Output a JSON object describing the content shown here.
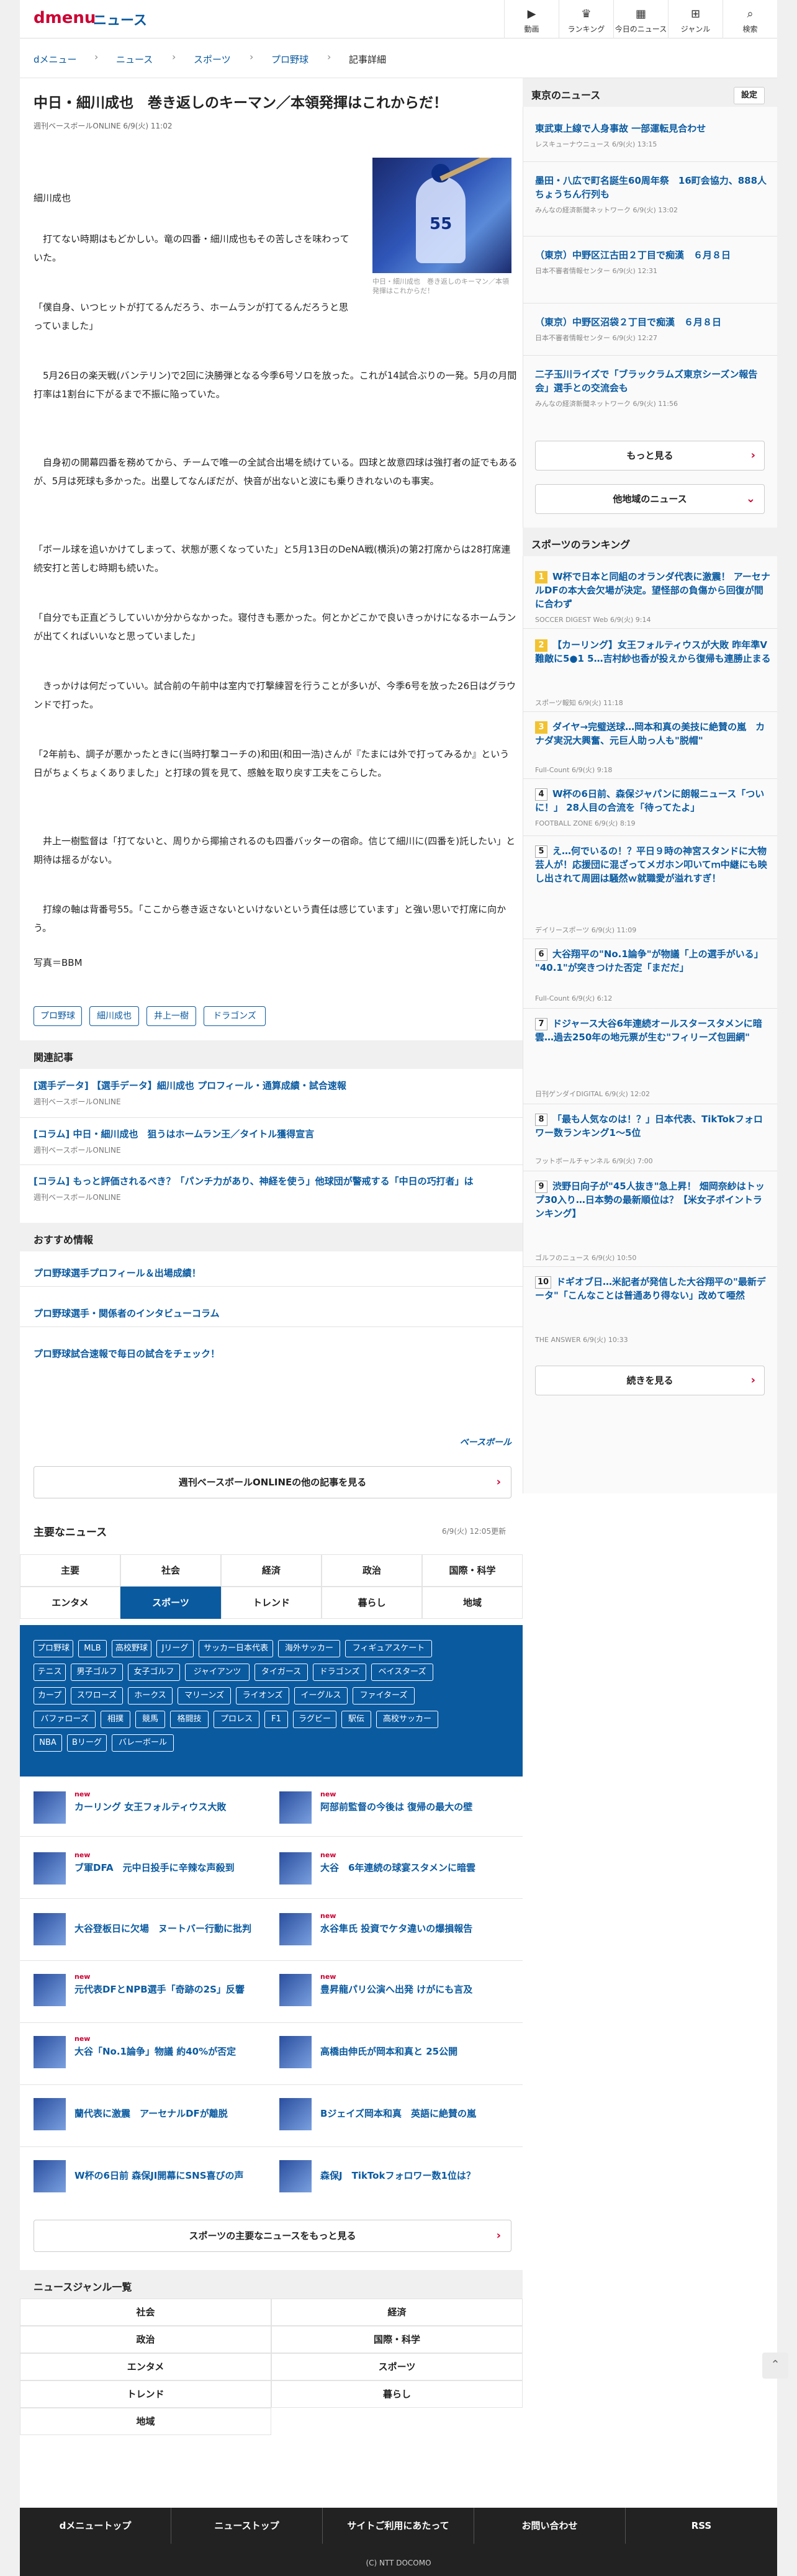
{
  "header": {
    "logo_brand": "dmenu",
    "logo_section": "ニュース",
    "nav": [
      {
        "icon": "video-icon",
        "glyph": "▶",
        "label": "動画"
      },
      {
        "icon": "trophy-icon",
        "glyph": "♛",
        "label": "ランキング"
      },
      {
        "icon": "calendar-icon",
        "glyph": "▦",
        "label": "今日のニュース"
      },
      {
        "icon": "grid-icon",
        "glyph": "⊞",
        "label": "ジャンル"
      },
      {
        "icon": "search-icon",
        "glyph": "⌕",
        "label": "検索"
      }
    ]
  },
  "breadcrumb": [
    "dメニュー",
    "ニュース",
    "スポーツ",
    "プロ野球",
    "記事詳細"
  ],
  "article": {
    "title": "中日・細川成也　巻き返しのキーマン／本領発揮はこれからだ！",
    "meta": "週刊ベースボールONLINE 6/9(火) 11:02",
    "image_caption": "中日・細川成也　巻き返しのキーマン／本領発揮はこれからだ！",
    "paragraphs": [
      "細川成也",
      "　打てない時期はもどかしい。竜の四番・細川成也もその苦しさを味わっていた。",
      "「僕自身、いつヒットが打てるんだろう、ホームランが打てるんだろうと思っていました」",
      "　5月26日の楽天戦(バンテリン)で2回に決勝弾となる今季6号ソロを放った。これが14試合ぶりの一発。5月の月間打率は1割台に下がるまで不振に陥っていた。",
      "　自身初の開幕四番を務めてから、チームで唯一の全試合出場を続けている。四球と故意四球は強打者の証でもあるが、5月は死球も多かった。出塁してなんぼだが、快音が出ないと波にも乗りきれないのも事実。",
      "「ボール球を追いかけてしまって、状態が悪くなっていた」と5月13日のDeNA戦(横浜)の第2打席からは28打席連続安打と苦しむ時期も続いた。",
      "「自分でも正直どうしていいか分からなかった。寝付きも悪かった。何とかどこかで良いきっかけになるホームランが出てくればいいなと思っていました」",
      "　きっかけは何だっていい。試合前の午前中は室内で打撃練習を行うことが多いが、今季6号を放った26日はグラウンドで打った。",
      "「2年前も、調子が悪かったときに(当時打撃コーチの)和田(和田一浩)さんが『たまには外で打ってみるか』という日がちょくちょくありました」と打球の質を見て、感触を取り戻す工夫をこらした。",
      "　井上一樹監督は「打てないと、周りから揶揄されるのも四番バッターの宿命。信じて細川に(四番を)託したい」と期待は揺るがない。",
      "　打線の軸は背番号55。「ここから巻き返さないといけないという責任は感じています」と強い思いで打席に向かう。",
      "写真＝BBM"
    ],
    "tags": [
      "プロ野球",
      "細川成也",
      "井上一樹",
      "ドラゴンズ"
    ]
  },
  "related": {
    "heading": "関連記事",
    "items": [
      {
        "title": "[選手データ] 【選手データ】細川成也 プロフィール・通算成績・試合速報",
        "source": "週刊ベースボールONLINE"
      },
      {
        "title": "[コラム] 中日・細川成也　狙うはホームラン王／タイトル獲得宣言",
        "source": "週刊ベースボールONLINE"
      },
      {
        "title": "[コラム] もっと評価されるべき？「パンチ力があり、神経を使う」他球団が警戒する「中日の巧打者」は",
        "source": "週刊ベースボールONLINE"
      }
    ]
  },
  "recommend": {
    "heading": "おすすめ情報",
    "items": [
      "プロ野球選手プロフィール＆出場成績！",
      "プロ野球選手・関係者のインタビューコラム",
      "プロ野球試合速報で毎日の試合をチェック！"
    ],
    "logo": "ベースボール",
    "more_button": "週刊ベースボールONLINEの他の記事を見る"
  },
  "main_news": {
    "heading": "主要なニュース",
    "updated": "6/9(火) 12:05更新",
    "tabs_row1": [
      "主要",
      "社会",
      "経済",
      "政治",
      "国際・科学"
    ],
    "tabs_row2": [
      "エンタメ",
      "スポーツ",
      "トレンド",
      "暮らし",
      "地域"
    ],
    "active_tab": "スポーツ",
    "keywords": [
      [
        "プロ野球",
        "MLB",
        "高校野球",
        "Jリーグ",
        "サッカー日本代表",
        "海外サッカー",
        "フィギュアスケート"
      ],
      [
        "テニス",
        "男子ゴルフ",
        "女子ゴルフ",
        "ジャイアンツ",
        "タイガース",
        "ドラゴンズ",
        "ベイスターズ"
      ],
      [
        "カープ",
        "スワローズ",
        "ホークス",
        "マリーンズ",
        "ライオンズ",
        "イーグルス",
        "ファイターズ"
      ],
      [
        "バファローズ",
        "相撲",
        "競馬",
        "格闘技",
        "プロレス",
        "F1",
        "ラグビー",
        "駅伝",
        "高校サッカー"
      ],
      [
        "NBA",
        "Bリーグ",
        "バレーボール"
      ]
    ],
    "new_label": "new",
    "items": [
      {
        "title": "カーリング 女王フォルティウス大敗",
        "new": true
      },
      {
        "title": "阿部前監督の今後は 復帰の最大の壁",
        "new": true
      },
      {
        "title": "ブ軍DFA　元中日投手に辛辣な声殺到",
        "new": true
      },
      {
        "title": "大谷　6年連続の球宴スタメンに暗雲",
        "new": true
      },
      {
        "title": "大谷登板日に欠場　ヌートバー行動に批判",
        "new": false
      },
      {
        "title": "水谷隼氏 投資でケタ違いの爆損報告",
        "new": true
      },
      {
        "title": "元代表DFとNPB選手「奇跡の2S」反響",
        "new": true
      },
      {
        "title": "豊昇龍パリ公演へ出発 けがにも言及",
        "new": true
      },
      {
        "title": "大谷「No.1論争」物議 約40%が否定",
        "new": true
      },
      {
        "title": "高橋由伸氏が岡本和真と 25公開",
        "new": false
      },
      {
        "title": "蘭代表に激震　アーセナルDFが離脱",
        "new": false
      },
      {
        "title": "Bジェイズ岡本和真　英語に絶賛の嵐",
        "new": false
      },
      {
        "title": "W杯の6日前 森保JI開幕にSNS喜びの声",
        "new": false
      },
      {
        "title": "森保J　TikTokフォロワー数1位は？",
        "new": false
      }
    ],
    "more_button": "スポーツの主要なニュースをもっと見る"
  },
  "genres": {
    "heading": "ニュースジャンル一覧",
    "items": [
      "社会",
      "経済",
      "政治",
      "国際・科学",
      "エンタメ",
      "スポーツ",
      "トレンド",
      "暮らし",
      "地域"
    ]
  },
  "footer": {
    "links": [
      "dメニュートップ",
      "ニューストップ",
      "サイトご利用にあたって",
      "お問い合わせ",
      "RSS"
    ],
    "copyright": "(C) NTT DOCOMO"
  },
  "sidebar": {
    "local": {
      "heading": "東京のニュース",
      "settings": "設定",
      "items": [
        {
          "title": "東武東上線で人身事故 一部運転見合わせ",
          "source": "レスキューナウニュース 6/9(火) 13:15"
        },
        {
          "title": "墨田・八広で町名誕生60周年祭　16町会協力、888人ちょうちん行列も",
          "source": "みんなの経済新聞ネットワーク 6/9(火) 13:02"
        },
        {
          "title": "（東京）中野区江古田２丁目で痴漢　６月８日",
          "source": "日本不審者情報センター 6/9(火) 12:31"
        },
        {
          "title": "（東京）中野区沼袋２丁目で痴漢　６月８日",
          "source": "日本不審者情報センター 6/9(火) 12:27"
        },
        {
          "title": "二子玉川ライズで「ブラックラムズ東京シーズン報告会」選手との交流会も",
          "source": "みんなの経済新聞ネットワーク 6/9(火) 11:56"
        }
      ],
      "more": "もっと見る",
      "other_region": "他地域のニュース"
    },
    "ranking": {
      "heading": "スポーツのランキング",
      "items": [
        {
          "title": "W杯で日本と同組のオランダ代表に激震！ アーセナルDFの本大会欠場が決定。望怪部の負傷から回復が間に合わず",
          "source": "SOCCER DIGEST Web 6/9(火) 9:14"
        },
        {
          "title": "【カーリング】女王フォルティウスが大敗 昨年準V難敵に5●1 5…吉村紗也香が投えから復帰も連勝止まる",
          "source": "スポーツ報知 6/9(火) 11:18"
        },
        {
          "title": "ダイヤ→完璧送球…岡本和真の美技に絶賛の嵐　カナダ実況大興奮、元巨人助っ人も\"脱帽\"",
          "source": "Full-Count 6/9(火) 9:18"
        },
        {
          "title": "W杯の6日前、森保ジャパンに朗報ニュース「ついに！」 28人目の合流を「待ってたよ」",
          "source": "FOOTBALL ZONE 6/9(火) 8:19"
        },
        {
          "title": "え…何でいるの！？平日９時の神宮スタンドに大物芸人が！応援団に混ざってメガホン叩いてｍ中継にも映し出されて周囲は騒然ｗ就職愛が溢れすぎ！",
          "source": "デイリースポーツ 6/9(火) 11:09"
        },
        {
          "title": "大谷翔平の\"No.1論争\"が物議「上の選手がいる」 \"40.1\"が突きつけた否定「まだだ」",
          "source": "Full-Count 6/9(火) 6:12"
        },
        {
          "title": "ドジャース大谷6年連続オールスタースタメンに暗雲…過去250年の地元票が生む\"フィリーズ包囲網\"",
          "source": "日刊ゲンダイDIGITAL 6/9(火) 12:02"
        },
        {
          "title": "「最も人気なのは！？」日本代表、TikTokフォロワー数ランキング1～5位",
          "source": "フットボールチャンネル 6/9(火) 7:00"
        },
        {
          "title": "渋野日向子が\"45人抜き\"急上昇！ 畑岡奈紗はトップ30入り…日本勢の最新順位は？【米女子ポイントランキング】",
          "source": "ゴルフのニュース 6/9(火) 10:50"
        },
        {
          "title": "ドギオブ日…米記者が発信した大谷翔平の\"最新データ\"「こんなことは普通あり得ない」改めて唖然",
          "source": "THE ANSWER 6/9(火) 10:33"
        }
      ],
      "more": "続きを見る"
    }
  },
  "colors": {
    "accent": "#0a5aa0",
    "brand": "#cc0033",
    "rank_gold": "#f2c230"
  }
}
